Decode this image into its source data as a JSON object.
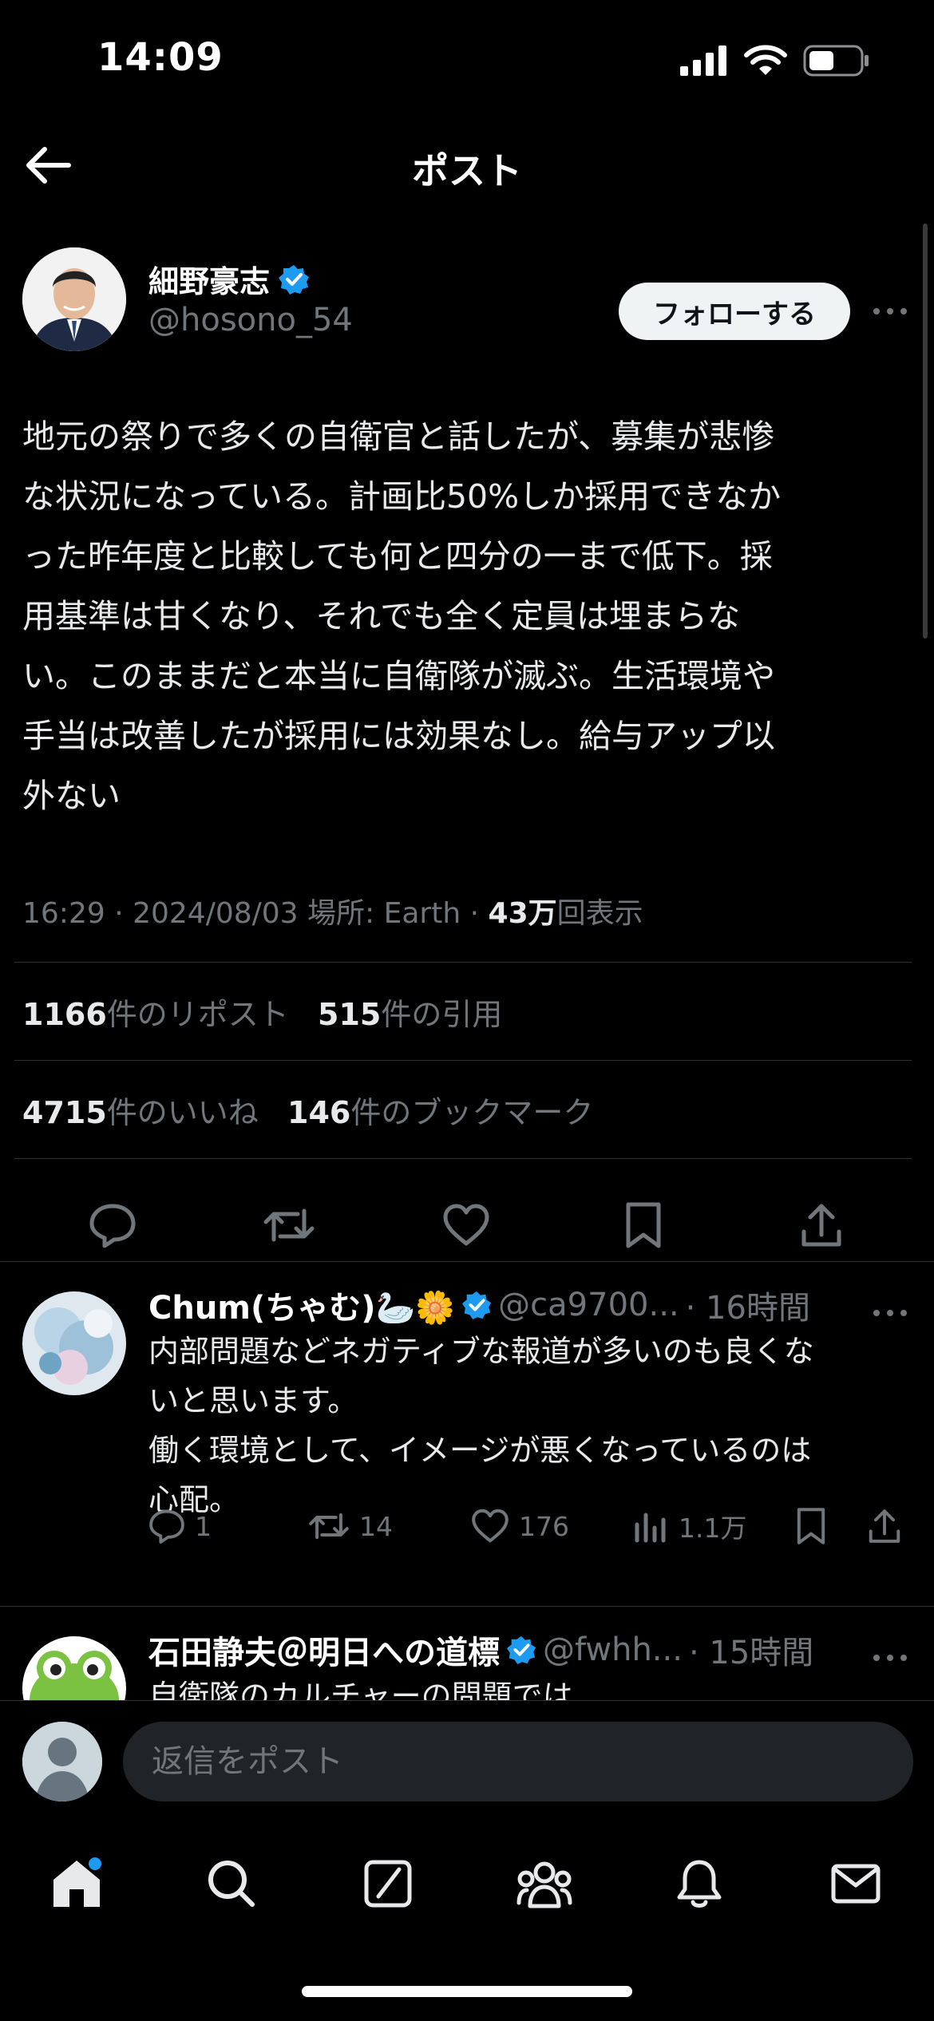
{
  "status_bar": {
    "time": "14:09"
  },
  "header": {
    "title": "ポスト"
  },
  "post": {
    "author_name": "細野豪志",
    "author_handle": "@hosono_54",
    "follow_label": "フォローする",
    "text": "地元の祭りで多くの自衛官と話したが、募集が悲惨\nな状況になっている。計画比50%しか採用できなか\nった昨年度と比較しても何と四分の一まで低下。採\n用基準は甘くなり、それでも全く定員は埋まらな\nい。このままだと本当に自衛隊が滅ぶ。生活環境や\n手当は改善したが採用には効果なし。給与アップ以\n外ない",
    "time": "16:29",
    "date": "2024/08/03",
    "location": "場所: Earth",
    "views_count": "43万",
    "views_label": "回表示",
    "reposts_count": "1166",
    "reposts_label": "件のリポスト",
    "quotes_count": "515",
    "quotes_label": "件の引用",
    "likes_count": "4715",
    "likes_label": "件のいいね",
    "bookmarks_count": "146",
    "bookmarks_label": "件のブックマーク"
  },
  "replies": [
    {
      "name": "Chum(ちゃむ)🦢🌼",
      "handle": "@ca9700...",
      "time": "· 16時間",
      "text": "内部問題などネガティブな報道が多いのも良くな\nいと思います。\n働く環境として、イメージが悪くなっているのは\n心配。",
      "replies": "1",
      "reposts": "14",
      "likes": "176",
      "views": "1.1万"
    },
    {
      "name": "石田静夫＠明日への道標",
      "handle": "@fwhh...",
      "time": "· 15時間",
      "text": "自衛隊のカルチャーの問題では"
    }
  ],
  "composer": {
    "placeholder": "返信をポスト"
  },
  "colors": {
    "background": "#000000",
    "accent": "#1d9bf0",
    "muted": "#71767b",
    "verified": "#1d9bf0"
  },
  "icons": [
    "back-arrow-icon",
    "verified-badge-icon",
    "more-icon",
    "reply-icon",
    "repost-icon",
    "like-icon",
    "bookmark-icon",
    "share-icon",
    "views-icon",
    "home-icon",
    "search-icon",
    "grok-icon",
    "communities-icon",
    "notifications-icon",
    "messages-icon"
  ]
}
